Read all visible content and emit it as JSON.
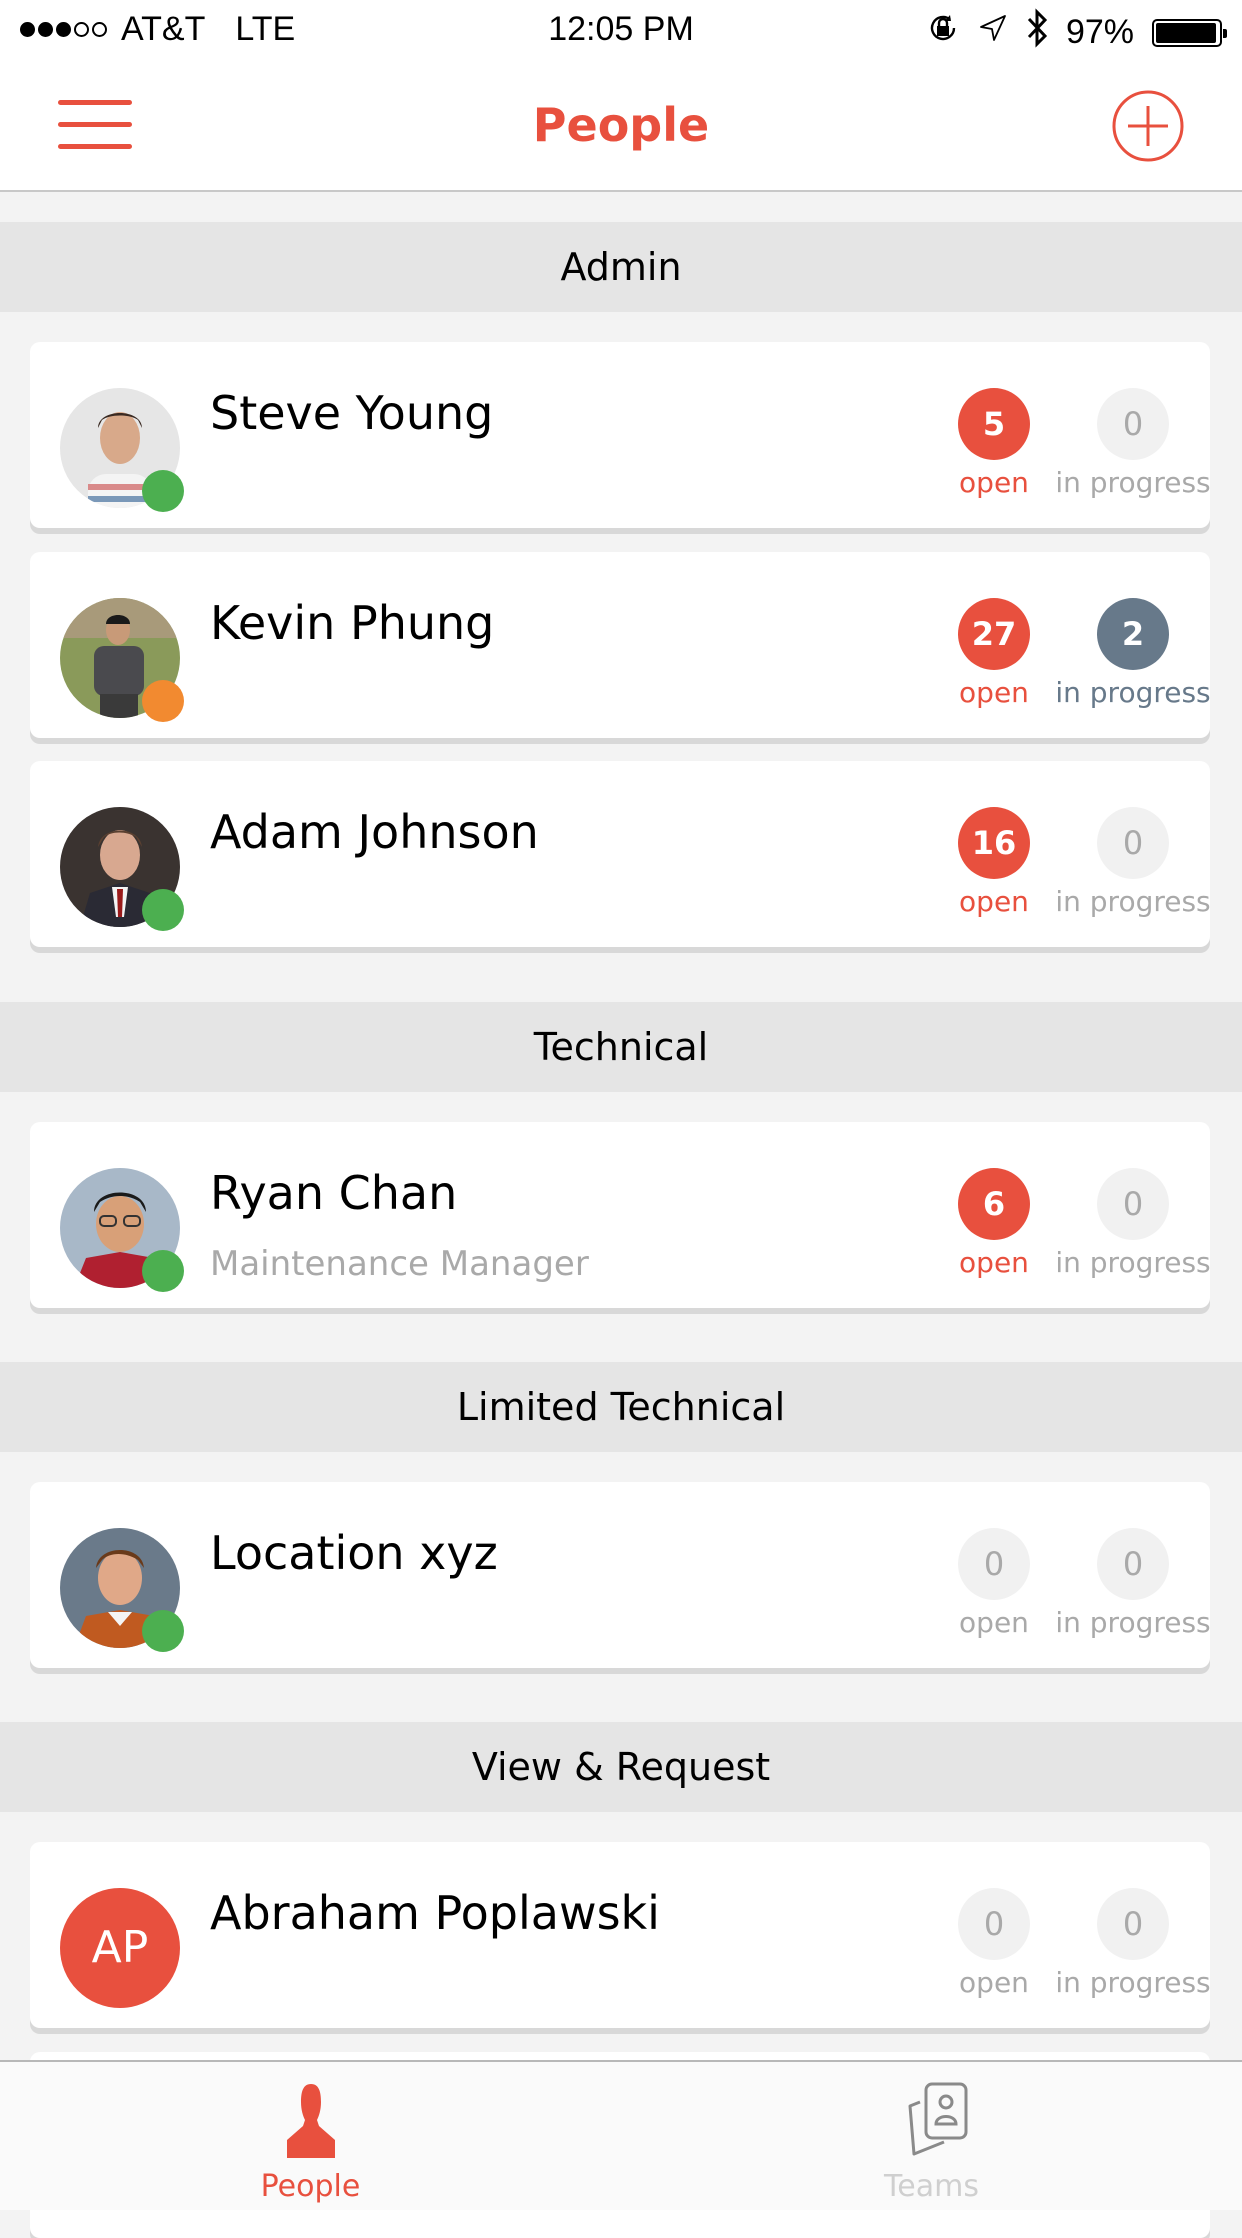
{
  "status_bar": {
    "signal_dots_filled": 3,
    "signal_dots_total": 5,
    "carrier": "AT&T",
    "network": "LTE",
    "time": "12:05 PM",
    "battery_percent": "97%",
    "icons": [
      "orientation-lock-icon",
      "location-arrow-icon",
      "bluetooth-icon",
      "battery-icon"
    ]
  },
  "nav": {
    "title": "People",
    "left_icon": "hamburger-menu-icon",
    "right_icon": "add-circle-icon"
  },
  "colors": {
    "accent": "#e8503e",
    "online": "#4caf50",
    "away": "#f28a30",
    "in_progress_active": "#67798a",
    "inactive_badge_bg": "#f1f1f1",
    "inactive_text": "#a9a9a9"
  },
  "labels": {
    "open": "open",
    "in_progress": "in progress"
  },
  "sections": [
    {
      "title": "Admin",
      "people": [
        {
          "name": "Steve Young",
          "role": "",
          "status": "online",
          "open": "5",
          "in_progress": "0"
        },
        {
          "name": "Kevin Phung",
          "role": "",
          "status": "away",
          "open": "27",
          "in_progress": "2"
        },
        {
          "name": "Adam Johnson",
          "role": "",
          "status": "online",
          "open": "16",
          "in_progress": "0"
        }
      ]
    },
    {
      "title": "Technical",
      "people": [
        {
          "name": "Ryan Chan",
          "role": "Maintenance Manager",
          "status": "online",
          "open": "6",
          "in_progress": "0"
        }
      ]
    },
    {
      "title": "Limited Technical",
      "people": [
        {
          "name": "Location xyz",
          "role": "",
          "status": "online",
          "open": "0",
          "in_progress": "0"
        }
      ]
    },
    {
      "title": "View & Request",
      "people": [
        {
          "name": "Abraham Poplawski",
          "role": "",
          "initials": "AP",
          "open": "0",
          "in_progress": "0"
        }
      ]
    }
  ],
  "tabs": [
    {
      "label": "People",
      "icon": "person-icon",
      "active": true
    },
    {
      "label": "Teams",
      "icon": "teams-cards-icon",
      "active": false
    }
  ]
}
